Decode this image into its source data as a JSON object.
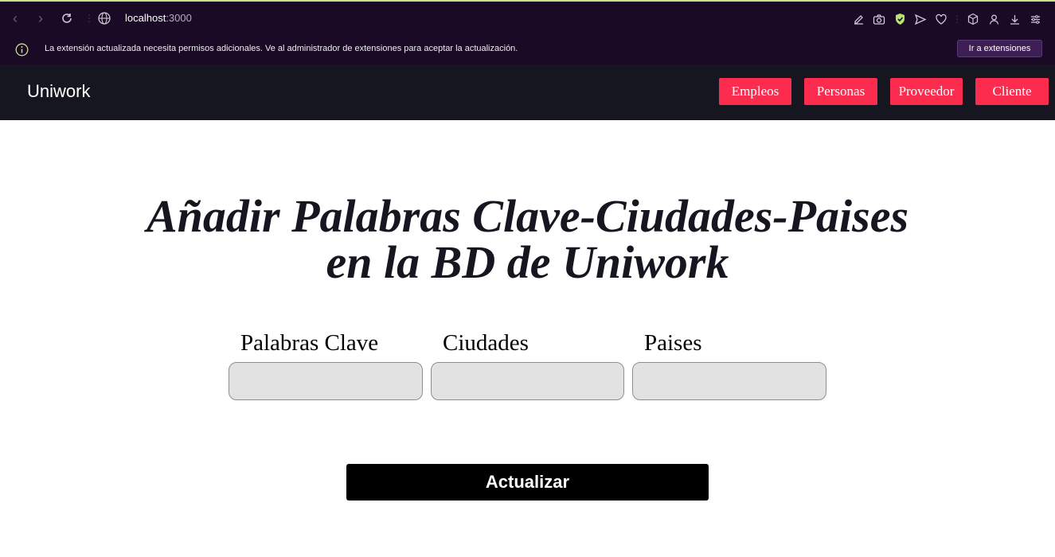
{
  "browser": {
    "url_host": "localhost",
    "url_port": ":3000",
    "icons": [
      "edit-icon",
      "camera-icon",
      "shield-check-icon",
      "send-icon",
      "heart-icon",
      "box-icon",
      "user-icon",
      "download-icon",
      "settings-icon"
    ],
    "accent_color": "#c8e08a"
  },
  "notification": {
    "text": "La extensión actualizada necesita permisos adicionales. Ve al administrador de extensiones para aceptar la actualización.",
    "button_label": "Ir a extensiones"
  },
  "navbar": {
    "brand": "Uniwork",
    "links": [
      "Empleos",
      "Personas",
      "Proveedor",
      "Cliente"
    ],
    "link_color": "#fb2c4e"
  },
  "main": {
    "title_line1": "Añadir Palabras Clave-Ciudades-Paises",
    "title_line2": "en la BD de Uniwork",
    "fields": [
      {
        "label": "Palabras Clave",
        "value": ""
      },
      {
        "label": "Ciudades",
        "value": ""
      },
      {
        "label": "Paises",
        "value": ""
      }
    ],
    "submit_label": "Actualizar"
  }
}
